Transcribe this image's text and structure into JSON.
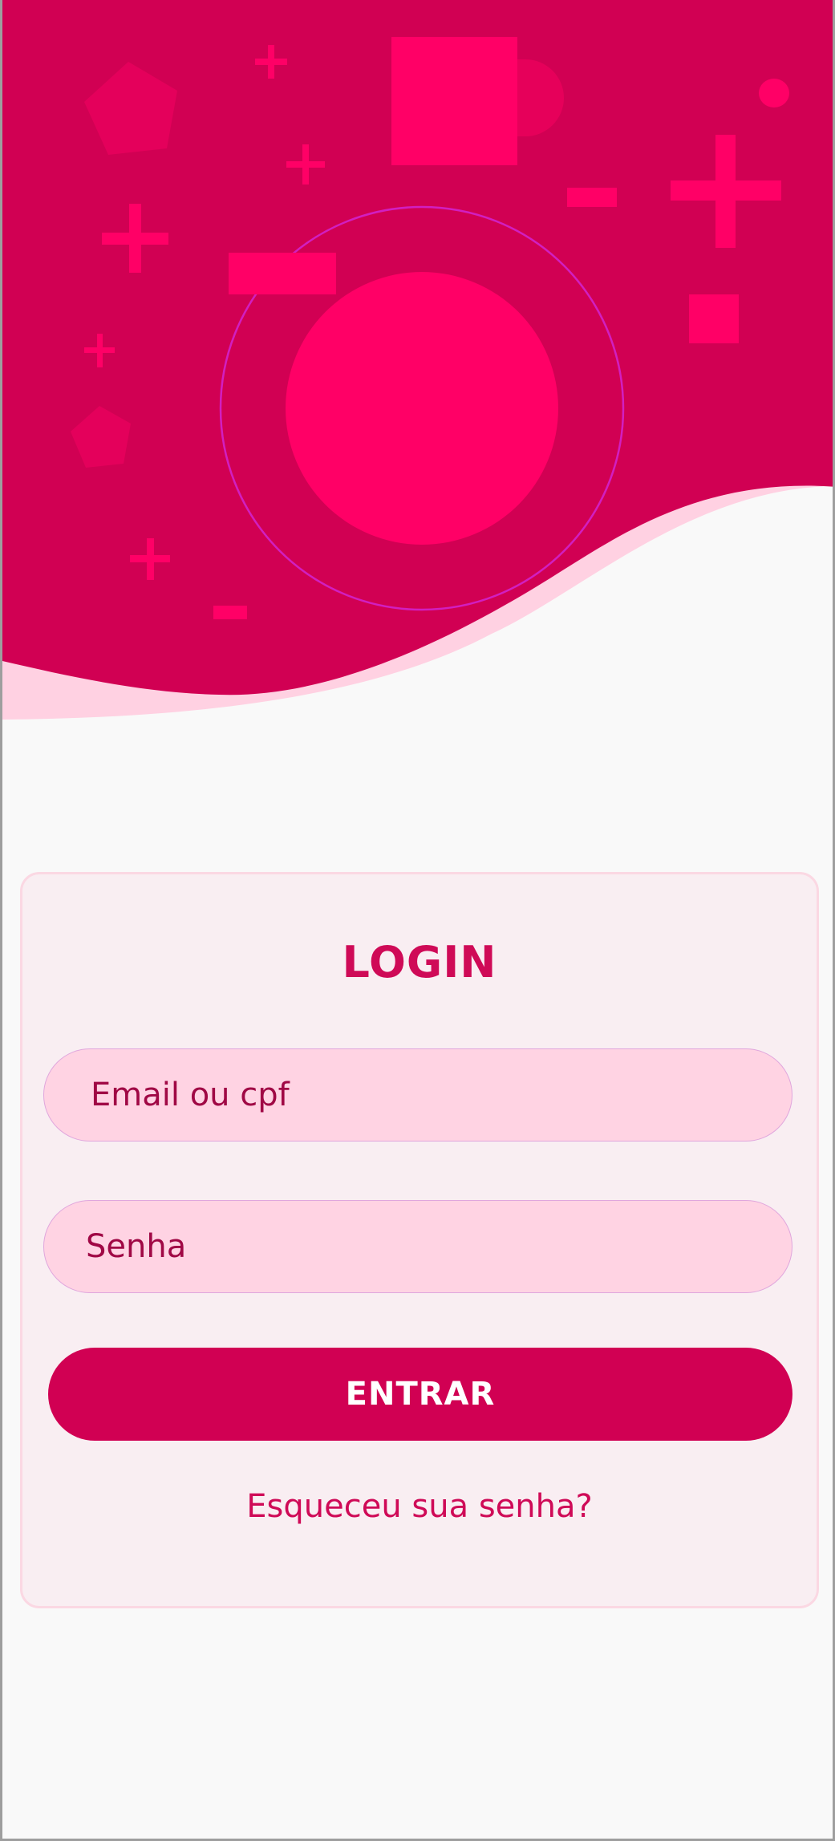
{
  "colors": {
    "hero_background": "#d10053",
    "accent_shapes": "#ff0066",
    "wave_highlight": "#ffd1e2",
    "ring_outline": "#d11fc1",
    "card_background": "#f9eef2",
    "field_background": "#ffd3e3",
    "button_background": "#d10053",
    "title_text": "#cf0a57"
  },
  "hero": {
    "decorations": [
      "pentagon",
      "plus",
      "square",
      "circle",
      "ring",
      "rectangle",
      "dash"
    ]
  },
  "login": {
    "title": "LOGIN",
    "email_placeholder": "Email ou cpf",
    "password_placeholder": "Senha",
    "submit_label": "ENTRAR",
    "forgot_password_label": "Esqueceu sua senha?"
  }
}
